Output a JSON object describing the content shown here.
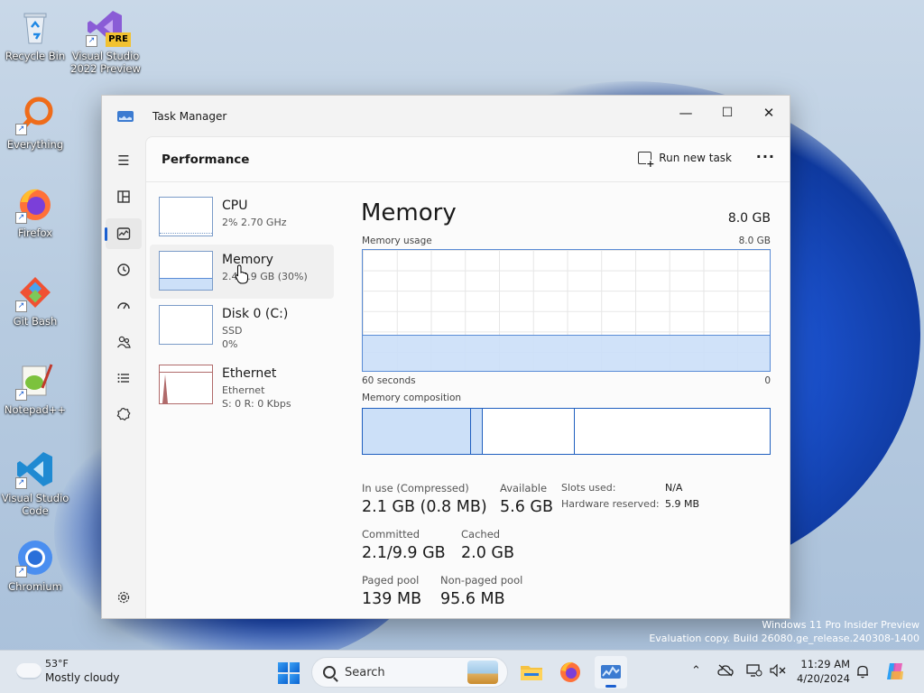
{
  "desktop": {
    "icons": [
      {
        "label": "Recycle Bin"
      },
      {
        "label": "Visual Studio 2022 Preview",
        "badge": "PRE"
      },
      {
        "label": "Everything"
      },
      {
        "label": "Firefox"
      },
      {
        "label": "Git Bash"
      },
      {
        "label": "Notepad++"
      },
      {
        "label": "Visual Studio Code"
      },
      {
        "label": "Chromium"
      }
    ],
    "watermark_line1": "Windows 11 Pro Insider Preview",
    "watermark_line2": "Evaluation copy. Build 26080.ge_release.240308-1400"
  },
  "window": {
    "title": "Task Manager",
    "controls": {
      "minimize": "—",
      "maximize": "☐",
      "close": "✕"
    }
  },
  "header": {
    "title": "Performance",
    "run_task_label": "Run new task",
    "more_label": "···"
  },
  "devices": [
    {
      "name": "CPU",
      "sub1": "2%  2.70 GHz"
    },
    {
      "name": "Memory",
      "sub1": "2.4/7.9 GB (30%)"
    },
    {
      "name": "Disk 0 (C:)",
      "sub1": "SSD",
      "sub2": "0%"
    },
    {
      "name": "Ethernet",
      "sub1": "Ethernet",
      "sub2": "S: 0  R: 0 Kbps"
    }
  ],
  "memory": {
    "title": "Memory",
    "total": "8.0 GB",
    "usage_label": "Memory usage",
    "usage_max": "8.0 GB",
    "usage_fraction": 0.3,
    "time_label": "60 seconds",
    "zero_label": "0",
    "composition_label": "Memory composition",
    "composition": {
      "in_use": 0.265,
      "modified": 0.03,
      "standby": 0.227,
      "free": 0.478
    },
    "stats": {
      "in_use_label": "In use (Compressed)",
      "in_use_value": "2.1 GB (0.8 MB)",
      "available_label": "Available",
      "available_value": "5.6 GB",
      "committed_label": "Committed",
      "committed_value": "2.1/9.9 GB",
      "cached_label": "Cached",
      "cached_value": "2.0 GB",
      "paged_label": "Paged pool",
      "paged_value": "139 MB",
      "nonpaged_label": "Non-paged pool",
      "nonpaged_value": "95.6 MB",
      "slots_label": "Slots used:",
      "slots_value": "N/A",
      "hw_label": "Hardware reserved:",
      "hw_value": "5.9 MB"
    }
  },
  "taskbar": {
    "weather_temp": "53°F",
    "weather_desc": "Mostly cloudy",
    "search_placeholder": "Search",
    "time": "11:29 AM",
    "date": "4/20/2024",
    "tray_chevron": "^"
  },
  "colors": {
    "accent": "#1a5fd0",
    "memory_line": "#5a8cd6",
    "memory_fill": "#cce0f8",
    "ethernet": "#b06a6a"
  }
}
